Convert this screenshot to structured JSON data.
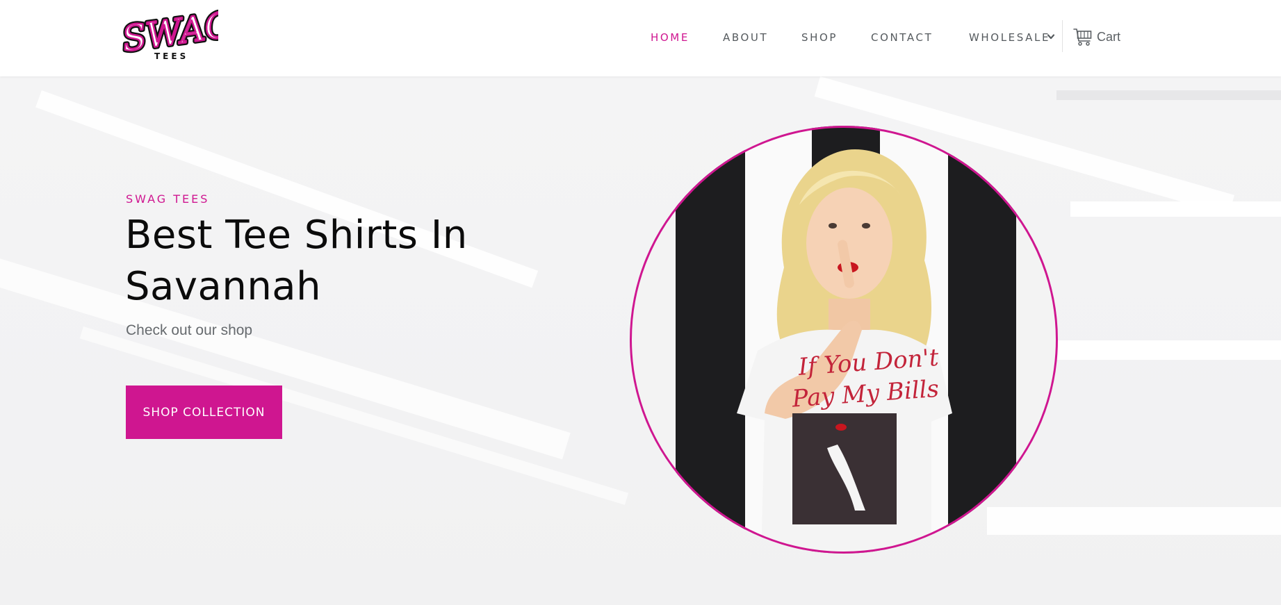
{
  "brand": {
    "logo_text": "SWAG",
    "logo_subtext": "TEES",
    "accent_color": "#cf1690"
  },
  "nav": {
    "items": [
      {
        "label": "HOME",
        "active": true
      },
      {
        "label": "ABOUT",
        "active": false
      },
      {
        "label": "SHOP",
        "active": false
      },
      {
        "label": "CONTACT",
        "active": false
      },
      {
        "label": "WHOLESALE",
        "active": false,
        "has_dropdown": true
      }
    ],
    "cart_label": "Cart",
    "cart_icon": "shopping-cart-icon",
    "dropdown_icon": "chevron-down-icon"
  },
  "hero": {
    "eyebrow": "SWAG TEES",
    "headline": "Best Tee Shirts In Savannah",
    "subtext": "Check out our shop",
    "cta_label": "SHOP COLLECTION"
  },
  "hero_image": {
    "shirt_text": "If You Don't Pay My Bills",
    "frame_color": "#cf1690"
  }
}
